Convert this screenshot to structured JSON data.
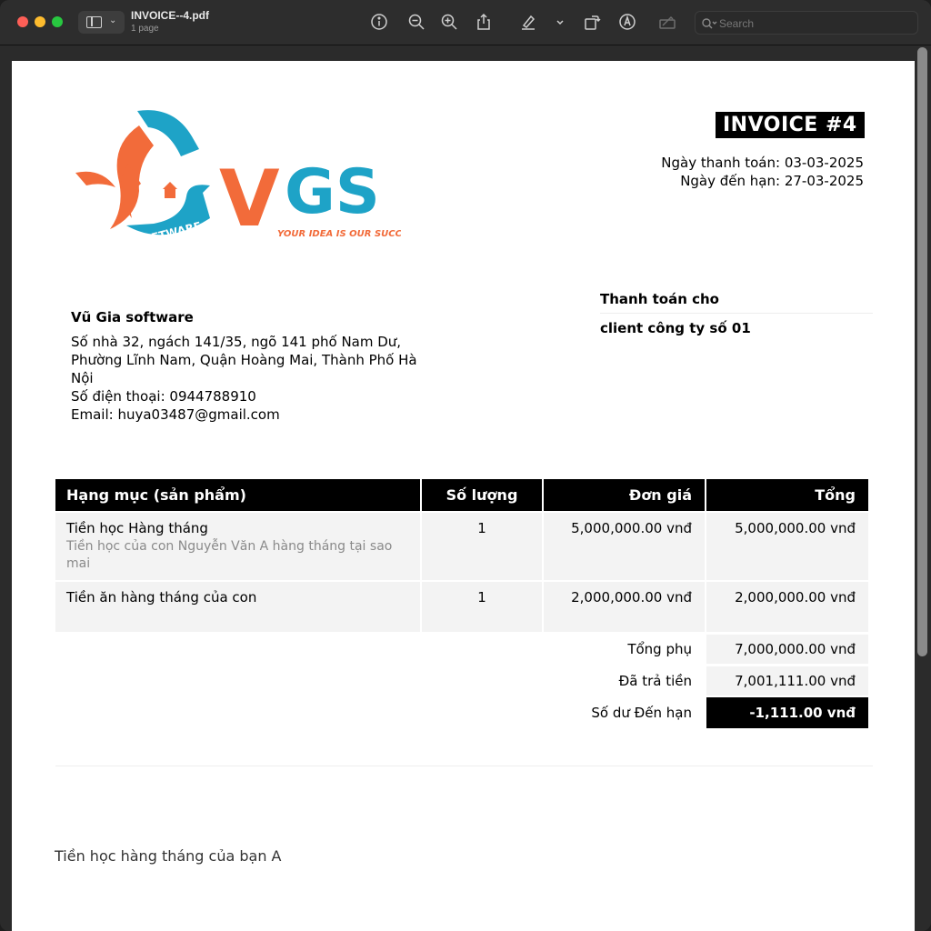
{
  "window": {
    "doc_title": "INVOICE--4.pdf",
    "doc_subtitle": "1 page",
    "search_placeholder": "Search"
  },
  "icons": [
    "sidebar-icon",
    "info-icon",
    "zoom-out-icon",
    "zoom-in-icon",
    "share-icon",
    "highlight-icon",
    "rotate-icon",
    "markup-icon",
    "sign-icon",
    "search-icon"
  ],
  "invoice": {
    "title": "INVOICE #4",
    "payment_date": "Ngày thanh toán: 03-03-2025",
    "due_date": "Ngày đến hạn: 27-03-2025",
    "logo": {
      "brand": "VGS",
      "badge": "SOFTWARE",
      "tagline": "YOUR IDEA IS OUR SUCCESS",
      "colors": {
        "orange": "#f26b3a",
        "teal": "#1ea3c7"
      }
    },
    "from": {
      "name": "Vũ Gia software",
      "address": "Số nhà 32, ngách 141/35, ngõ 141 phố Nam Dư, Phường Lĩnh Nam, Quận Hoàng Mai, Thành Phố Hà Nội",
      "phone": "Số điện thoại: 0944788910",
      "email": "Email: huya03487@gmail.com"
    },
    "bill_to": {
      "label": "Thanh toán cho",
      "name": "client công ty số 01"
    },
    "table": {
      "headers": [
        "Hạng mục (sản phẩm)",
        "Số lượng",
        "Đơn giá",
        "Tổng"
      ],
      "rows": [
        {
          "item": "Tiền học Hàng tháng",
          "description": "Tiền học của con Nguyễn Văn A hàng tháng tại sao mai",
          "qty": "1",
          "unit_price": "5,000,000.00 vnđ",
          "total": "5,000,000.00 vnđ"
        },
        {
          "item": "Tiền ăn hàng tháng của con",
          "description": "",
          "qty": "1",
          "unit_price": "2,000,000.00 vnđ",
          "total": "2,000,000.00 vnđ"
        }
      ]
    },
    "summary": {
      "subtotal_label": "Tổng phụ",
      "subtotal": "7,000,000.00 vnđ",
      "paid_label": "Đã trả tiền",
      "paid": "7,001,111.00 vnđ",
      "balance_label": "Số dư Đến hạn",
      "balance": "-1,111.00 vnđ"
    },
    "note": "Tiền học hàng tháng của bạn A"
  }
}
